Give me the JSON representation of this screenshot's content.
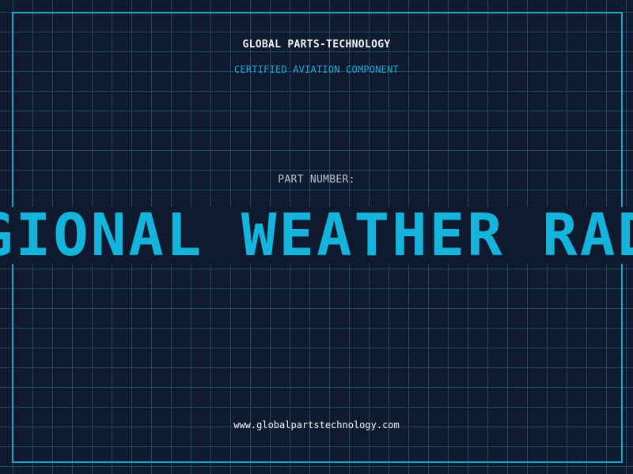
{
  "header": {
    "brand": "GLOBAL PARTS-TECHNOLOGY",
    "subtitle": "CERTIFIED AVIATION COMPONENT"
  },
  "part": {
    "label": "PART NUMBER:",
    "value": "REGIONAL WEATHER RADAR"
  },
  "footer": {
    "website": "www.globalpartstechnology.com"
  },
  "colors": {
    "background": "#101a2e",
    "grid": "#246e8c",
    "frame": "#1ea3cf",
    "accent": "#14b4dc",
    "text_light": "#f2f5f8",
    "text_muted": "#b9c4cf"
  }
}
